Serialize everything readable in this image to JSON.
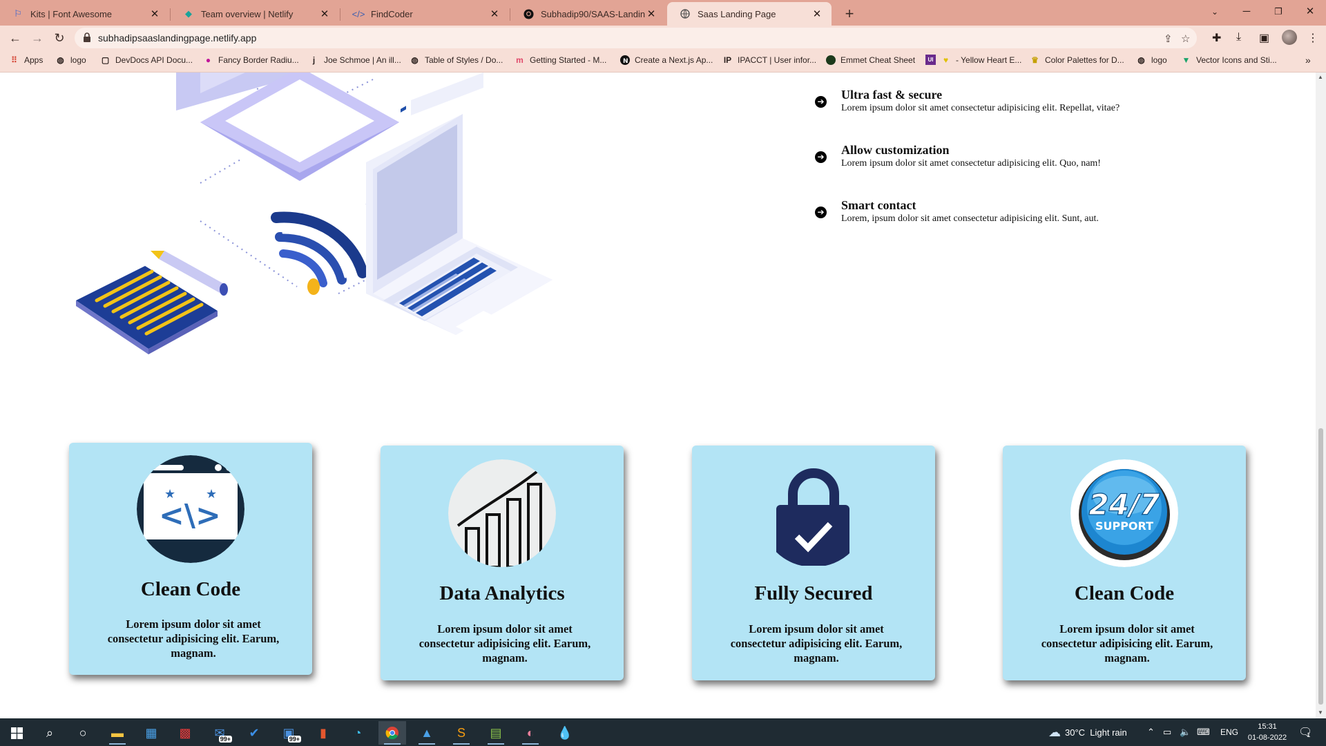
{
  "browser": {
    "tabs": [
      {
        "title": "Kits | Font Awesome",
        "icon": "flag-icon"
      },
      {
        "title": "Team overview | Netlify",
        "icon": "netlify-icon"
      },
      {
        "title": "FindCoder",
        "icon": "findcoder-icon"
      },
      {
        "title": "Subhadip90/SAAS-Landing-Page",
        "icon": "github-icon"
      },
      {
        "title": "Saas Landing Page",
        "icon": "globe-icon"
      }
    ],
    "url": "subhadipsaaslandingpage.netlify.app",
    "bookmarks": [
      "Apps",
      "logo",
      "DevDocs API Docu...",
      "Fancy Border Radiu...",
      "Joe Schmoe | An ill...",
      "Table of Styles / Do...",
      "Getting Started - M...",
      "Create a Next.js Ap...",
      "IPACCT | User infor...",
      "Emmet Cheat Sheet",
      "- Yellow Heart E...",
      "Color Palettes for D...",
      "logo",
      "Vector Icons and Sti..."
    ]
  },
  "features": [
    {
      "title": "Ultra fast & secure",
      "text": "Lorem ipsum dolor sit amet consectetur adipisicing elit. Repellat, vitae?"
    },
    {
      "title": "Allow customization",
      "text": "Lorem ipsum dolor sit amet consectetur adipisicing elit. Quo, nam!"
    },
    {
      "title": "Smart contact",
      "text": "Lorem, ipsum dolor sit amet consectetur adipisicing elit. Sunt, aut."
    }
  ],
  "cards": [
    {
      "title": "Clean Code",
      "text": "Lorem ipsum dolor sit amet consectetur adipisicing elit. Earum, magnam.",
      "icon": "code-window-icon"
    },
    {
      "title": "Data Analytics",
      "text": "Lorem ipsum dolor sit amet consectetur adipisicing elit. Earum, magnam.",
      "icon": "bar-chart-growth-icon"
    },
    {
      "title": "Fully Secured",
      "text": "Lorem ipsum dolor sit amet consectetur adipisicing elit. Earum, magnam.",
      "icon": "padlock-check-icon"
    },
    {
      "title": "Clean Code",
      "text": "Lorem ipsum dolor sit amet consectetur adipisicing elit. Earum, magnam.",
      "icon": "support-24-7-icon"
    }
  ],
  "support_badge": {
    "line1": "24/7",
    "line2": "SUPPORT"
  },
  "taskbar": {
    "badge1": "99+",
    "badge2": "99+",
    "weather": "30°C  Light rain",
    "lang": "ENG",
    "time": "15:31",
    "date": "01-08-2022",
    "notifications": "1"
  },
  "colors": {
    "card_bg": "#b3e4f5",
    "tabstrip": "#e2a495",
    "toolbar": "#f7dfd7",
    "taskbar": "#1f2b33"
  }
}
